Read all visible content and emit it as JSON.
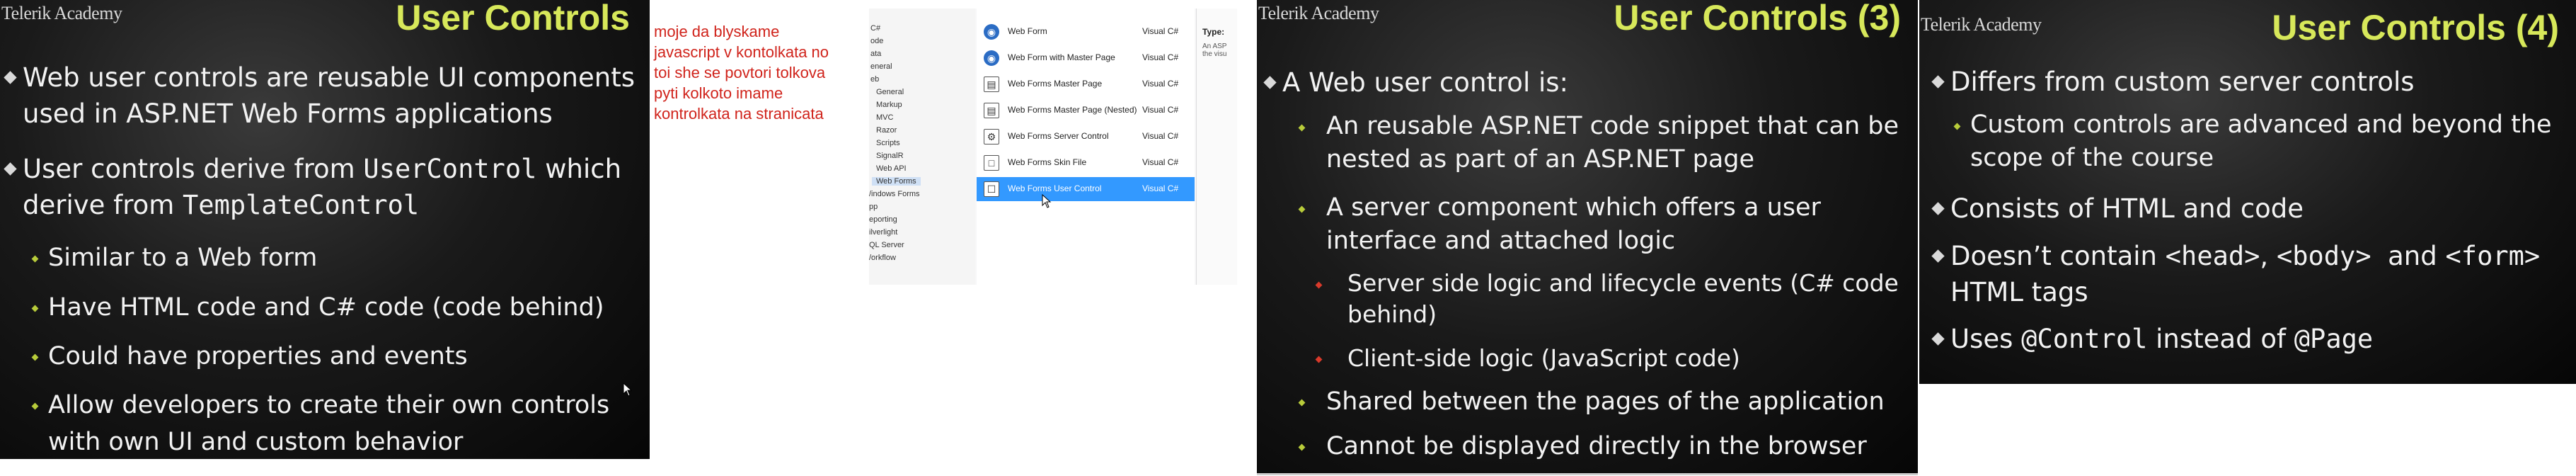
{
  "slide1": {
    "brand": "Telerik Academy",
    "title": "User Controls",
    "bullets": [
      {
        "lines": [
          "Web user controls are reusable UI components",
          "used in ASP.NET Web Forms applications"
        ]
      },
      {
        "line1_a": "User controls derive from ",
        "line1_code": "UserControl",
        "line1_b": " which",
        "line2_a": "derive from ",
        "line2_code": "TemplateControl"
      }
    ],
    "sub_bullets": [
      "Similar to a Web form",
      "Have HTML code and C# code (code behind)",
      "Could have properties and events",
      "Allow developers to create their own controls",
      "with own UI and custom behavior"
    ]
  },
  "note": {
    "lines": [
      "moje da blyskame",
      "javascript v kontolkata no",
      "toi she se povtori tolkova",
      "pyti kolkoto imame",
      "kontrolkata na stranicata"
    ]
  },
  "vs_dialog": {
    "tree": [
      "C#",
      "ode",
      "ata",
      "eneral",
      "eb",
      "General",
      "Markup",
      "MVC",
      "Razor",
      "Scripts",
      "SignalR",
      "Web API",
      "Web Forms",
      "/indows Forms",
      "pp",
      "eporting",
      "ilverlight",
      "QL Server",
      "/orkflow"
    ],
    "items": [
      {
        "name": "Web Form",
        "lang": "Visual C#"
      },
      {
        "name": "Web Form with Master Page",
        "lang": "Visual C#"
      },
      {
        "name": "Web Forms Master Page",
        "lang": "Visual C#"
      },
      {
        "name": "Web Forms Master Page (Nested)",
        "lang": "Visual C#"
      },
      {
        "name": "Web Forms Server Control",
        "lang": "Visual C#"
      },
      {
        "name": "Web Forms Skin File",
        "lang": "Visual C#"
      },
      {
        "name": "Web Forms User Control",
        "lang": "Visual C#"
      }
    ],
    "side_label": "Type:",
    "side_text": "An ASP the visu"
  },
  "slide3": {
    "brand": "Telerik Academy",
    "title": "User Controls (3)",
    "main": "A Web user control is:",
    "l2": [
      [
        "An reusable ASP.NET code snippet that can be",
        "nested as part of an ASP.NET page"
      ],
      [
        "A server component which offers a user",
        "interface and attached logic"
      ]
    ],
    "l3": [
      [
        "Server side logic and lifecycle events (C# code",
        "behind)"
      ],
      [
        "Client-side logic (JavaScript code)"
      ]
    ],
    "l2b": [
      "Shared between the pages of the application",
      "Cannot be displayed directly in the browser"
    ]
  },
  "slide4": {
    "brand": "Telerik Academy",
    "title": "User Controls (4)",
    "b1": "Differs from custom server controls",
    "b1_sub": [
      "Custom controls are advanced and beyond the",
      "scope of the course"
    ],
    "b2": "Consists of HTML and code",
    "b3_a": "Doesn’t contain ",
    "b3_code1": "<head>",
    "b3_sep1": ", ",
    "b3_code2": "<body>",
    "b3_sep2": "  and ",
    "b3_code3": "<form>",
    "b3_line2": "HTML tags",
    "b4_a": "Uses ",
    "b4_code1": "@Control",
    "b4_b": " instead of ",
    "b4_code2": "@Page"
  }
}
